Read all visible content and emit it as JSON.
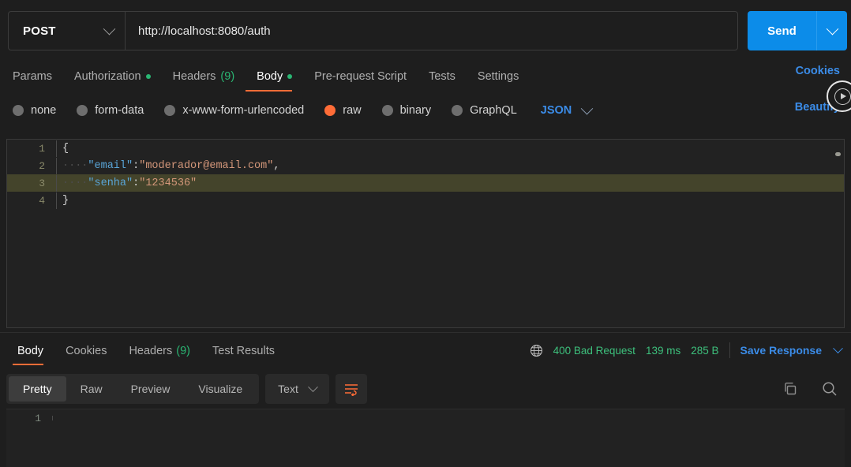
{
  "request": {
    "method": "POST",
    "url": "http://localhost:8080/auth",
    "send_label": "Send",
    "tabs": [
      {
        "label": "Params",
        "badge": "",
        "badge_type": "none",
        "active": false
      },
      {
        "label": "Authorization",
        "badge": "●",
        "badge_type": "dot",
        "active": false
      },
      {
        "label": "Headers",
        "badge": "(9)",
        "badge_type": "count",
        "active": false
      },
      {
        "label": "Body",
        "badge": "●",
        "badge_type": "dot",
        "active": true
      },
      {
        "label": "Pre-request Script",
        "badge": "",
        "badge_type": "none",
        "active": false
      },
      {
        "label": "Tests",
        "badge": "",
        "badge_type": "none",
        "active": false
      },
      {
        "label": "Settings",
        "badge": "",
        "badge_type": "none",
        "active": false
      }
    ],
    "body_types": [
      {
        "label": "none",
        "selected": false
      },
      {
        "label": "form-data",
        "selected": false
      },
      {
        "label": "x-www-form-urlencoded",
        "selected": false
      },
      {
        "label": "raw",
        "selected": true
      },
      {
        "label": "binary",
        "selected": false
      },
      {
        "label": "GraphQL",
        "selected": false
      }
    ],
    "raw_format": "JSON",
    "cookies_link": "Cookies",
    "beautify_link": "Beautify",
    "play_overlay_icon": "play-circle-icon",
    "editor": {
      "active_line": 3,
      "lines": [
        {
          "num": "1",
          "indent": "",
          "tokens": [
            {
              "t": "{",
              "c": "brace"
            }
          ]
        },
        {
          "num": "2",
          "indent": "····",
          "tokens": [
            {
              "t": "\"email\"",
              "c": "key"
            },
            {
              "t": ":",
              "c": "pun"
            },
            {
              "t": "\"moderador@email.com\"",
              "c": "str"
            },
            {
              "t": ",",
              "c": "pun"
            }
          ]
        },
        {
          "num": "3",
          "indent": "····",
          "tokens": [
            {
              "t": "\"senha\"",
              "c": "key"
            },
            {
              "t": ":",
              "c": "pun"
            },
            {
              "t": "\"1234536\"",
              "c": "str"
            }
          ]
        },
        {
          "num": "4",
          "indent": "",
          "tokens": [
            {
              "t": "}",
              "c": "brace"
            }
          ]
        }
      ]
    }
  },
  "response": {
    "tabs": [
      {
        "label": "Body",
        "badge": "",
        "active": true
      },
      {
        "label": "Cookies",
        "badge": "",
        "active": false
      },
      {
        "label": "Headers",
        "badge": "(9)",
        "active": false
      },
      {
        "label": "Test Results",
        "badge": "",
        "active": false
      }
    ],
    "status": "400 Bad Request",
    "time": "139 ms",
    "size": "285 B",
    "save_response_label": "Save Response",
    "globe_icon": "globe-icon",
    "view_modes": [
      {
        "label": "Pretty",
        "active": true
      },
      {
        "label": "Raw",
        "active": false
      },
      {
        "label": "Preview",
        "active": false
      },
      {
        "label": "Visualize",
        "active": false
      }
    ],
    "format": "Text",
    "wrap_icon": "wrap-lines-icon",
    "copy_icon": "copy-icon",
    "search_icon": "search-icon",
    "body_lines": [
      {
        "num": "1",
        "text": ""
      }
    ]
  },
  "colors": {
    "accent_orange": "#ff6c37",
    "link_blue": "#3b8ce8",
    "send_blue": "#0c8ce9",
    "status_green": "#3dc07c",
    "json_key": "#59a5d8",
    "json_string": "#d4977a",
    "active_line": "#44442b"
  }
}
